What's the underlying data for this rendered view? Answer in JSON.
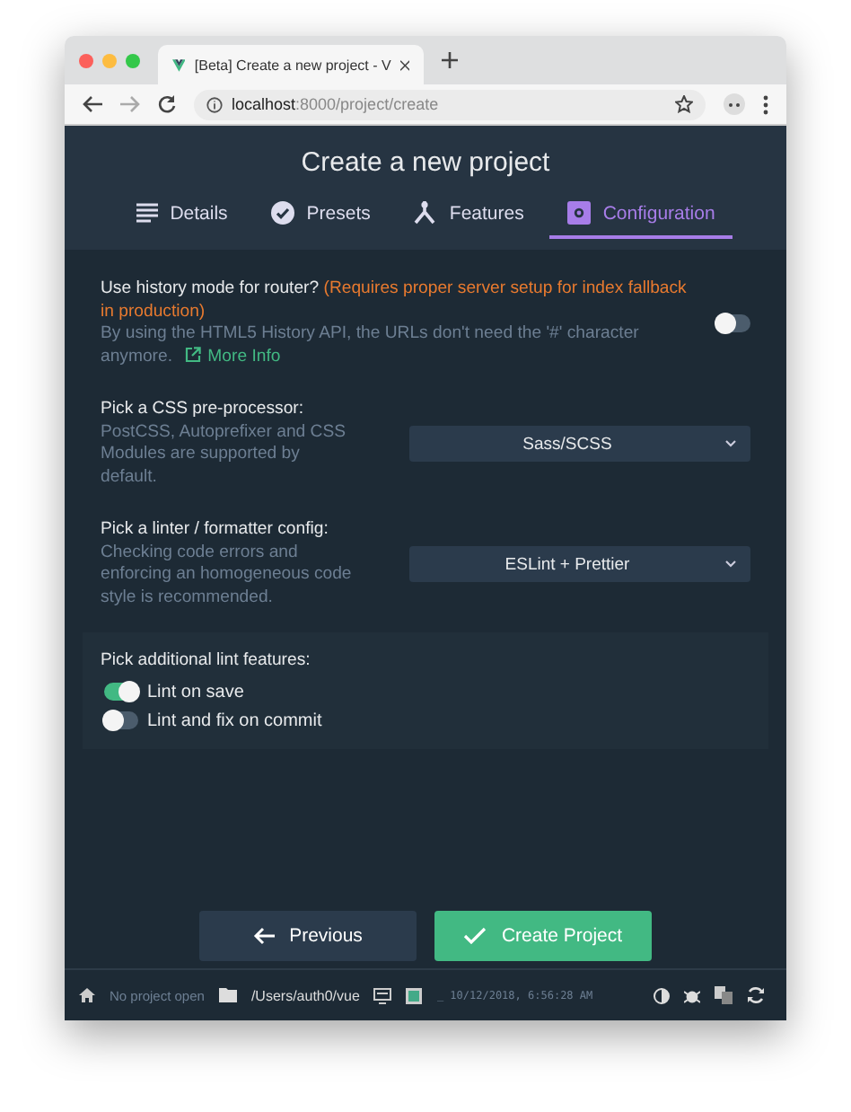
{
  "browser": {
    "tab_title": "[Beta] Create a new project - V",
    "url_host": "localhost",
    "url_path": ":8000/project/create"
  },
  "title": "Create a new project",
  "tabs": [
    {
      "label": "Details",
      "selected": false
    },
    {
      "label": "Presets",
      "selected": false
    },
    {
      "label": "Features",
      "selected": false
    },
    {
      "label": "Configuration",
      "selected": true
    }
  ],
  "settings": [
    {
      "kind": "toggle",
      "label": "Use history mode for router?",
      "warning": "(Requires proper server setup for index fallback in production)",
      "description": "By using the HTML5 History API, the URLs don't need the '#' character anymore.",
      "link": "More Info",
      "on": false
    },
    {
      "kind": "select",
      "label": "Pick a CSS pre-processor:",
      "description": "PostCSS, Autoprefixer and CSS Modules are supported by default.",
      "value": "Sass/SCSS"
    },
    {
      "kind": "select",
      "label": "Pick a linter / formatter config:",
      "description": "Checking code errors and enforcing an homogeneous code style is recommended.",
      "value": "ESLint + Prettier"
    },
    {
      "kind": "checklist",
      "label": "Pick additional lint features:",
      "options": [
        {
          "label": "Lint on save",
          "on": true
        },
        {
          "label": "Lint and fix on commit",
          "on": false
        }
      ]
    }
  ],
  "buttons": [
    {
      "kind": "back",
      "label": "Previous"
    },
    {
      "kind": "primary",
      "label": "Create Project"
    }
  ],
  "status_bar": {
    "project": "No project open",
    "folder": "/Users/auth0/vue",
    "log": "_ 10/12/2018, 6:56:28 AM"
  }
}
